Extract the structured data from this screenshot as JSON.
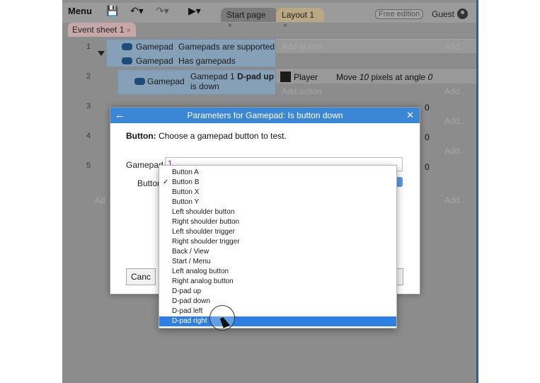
{
  "toolbar": {
    "menu_label": "Menu",
    "free_edition": "Free edition",
    "guest": "Guest"
  },
  "tabs": [
    {
      "label": "Start page",
      "close": "×"
    },
    {
      "label": "Layout 1",
      "close": "×"
    }
  ],
  "sheet_tab": {
    "label": "Event sheet 1",
    "close": "×"
  },
  "events": {
    "row_numbers": [
      "1",
      "2",
      "3",
      "4",
      "5"
    ],
    "row1": {
      "cond1_object": "Gamepad",
      "cond1_text": "Gamepads are supported",
      "cond2_object": "Gamepad",
      "cond2_text": "Has gamepads",
      "add_action": "Add action",
      "add": "Add..."
    },
    "row2": {
      "cond_object": "Gamepad",
      "cond_text_prefix": "Gamepad 1",
      "cond_text_bold": "D-pad up",
      "cond_text_suffix": "is down",
      "action_object": "Player",
      "action_prefix": "Move",
      "action_value": "10",
      "action_middle": "pixels at angle",
      "action_angle": "0",
      "add_action": "Add action",
      "add": "Add..."
    },
    "partial_values": [
      "0",
      "0",
      "0"
    ],
    "add_labels": [
      "Add...",
      "Add...",
      "Add..."
    ],
    "left_add": "Ad"
  },
  "dialog": {
    "back_icon": "←",
    "title": "Parameters for Gamepad: Is button down",
    "close_icon": "✕",
    "desc_bold": "Button:",
    "desc_text": "Choose a gamepad button to test.",
    "gamepad_label": "Gamepad",
    "gamepad_value": "1",
    "button_label": "Button",
    "cancel_label": "Canc"
  },
  "dropdown": {
    "selected": "Button B",
    "highlighted": "D-pad right",
    "options": [
      "Button A",
      "Button B",
      "Button X",
      "Button Y",
      "Left shoulder button",
      "Right shoulder button",
      "Left shoulder trigger",
      "Right shoulder trigger",
      "Back / View",
      "Start / Menu",
      "Left analog button",
      "Right analog button",
      "D-pad up",
      "D-pad down",
      "D-pad left",
      "D-pad right"
    ],
    "check_mark": "✓"
  },
  "colors": {
    "accent": "#3c86d6",
    "highlight": "#2e7fe0"
  }
}
